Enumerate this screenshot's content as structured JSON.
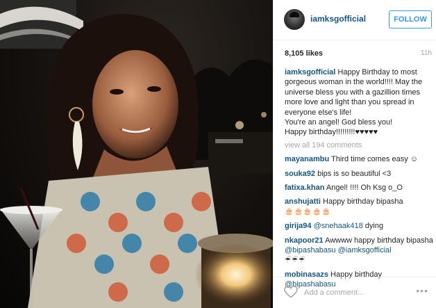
{
  "post": {
    "username": "iamksgofficial",
    "follow_label": "FOLLOW",
    "likes": "8,105 likes",
    "time": "11h",
    "caption_user": "iamksgofficial",
    "caption_lines": [
      " Happy Birthday to most gorgeous woman in the world!!!! May the universe bless you with a gazillion times more love and light than you spread in everyone else's life!",
      "You're an angel! God bless you!",
      "Happy birthday!!!!!!!!!♥♥♥♥♥"
    ],
    "view_all": "view all 194 comments",
    "comments": [
      {
        "user": "mayanambu",
        "text": " Third time comes easy ☺"
      },
      {
        "user": "souka92",
        "text": " bips is so beautiful <3"
      },
      {
        "user": "fatixa.khan",
        "text": " Angel! !!!! Oh Ksg o_O"
      },
      {
        "user": "anshujatti",
        "text": " Happy birthday bipasha",
        "extra": "🎂🎂🎂🎂🎂"
      },
      {
        "user": "girija94",
        "mention": " @snehaak418",
        "text": " dying"
      },
      {
        "user": "nkapoor21",
        "text": " Awwww happy birthday bipasha ",
        "mention": "@bipashabasu",
        "mention2": " @iamksgofficial",
        "extra": "☔☔☔"
      },
      {
        "user": "mobinasazs",
        "text": " Happy birthday ",
        "mention": "@bipashabasu"
      }
    ],
    "add_comment_placeholder": "Add a comment...",
    "more_label": "•••"
  },
  "colors": {
    "link_blue": "#125688",
    "follow_blue": "#3897f0",
    "muted_gray": "#a5a7aa"
  },
  "icons": {
    "heart": "heart-icon",
    "more": "more-options-icon"
  }
}
